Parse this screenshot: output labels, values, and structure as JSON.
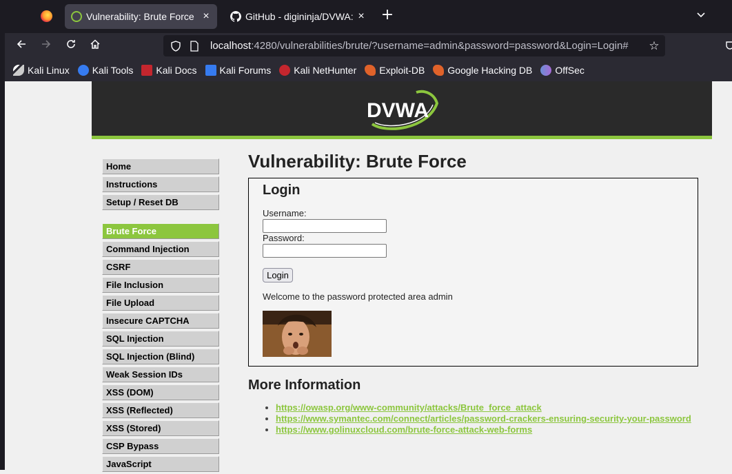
{
  "browser": {
    "tabs": [
      {
        "title": "Vulnerability: Brute Force",
        "active": true
      },
      {
        "title": "GitHub - digininja/DVWA:",
        "active": false
      }
    ],
    "url_host": "localhost",
    "url_rest": ":4280/vulnerabilities/brute/?username=admin&password=password&Login=Login#",
    "bookmarks": [
      {
        "label": "Kali Linux",
        "icon": "kali-dragon-icon"
      },
      {
        "label": "Kali Tools",
        "icon": "kali-tools-icon"
      },
      {
        "label": "Kali Docs",
        "icon": "kali-docs-icon"
      },
      {
        "label": "Kali Forums",
        "icon": "kali-forums-icon"
      },
      {
        "label": "Kali NetHunter",
        "icon": "kali-nethunter-icon"
      },
      {
        "label": "Exploit-DB",
        "icon": "exploit-db-icon"
      },
      {
        "label": "Google Hacking DB",
        "icon": "ghdb-icon"
      },
      {
        "label": "OffSec",
        "icon": "offsec-icon"
      }
    ]
  },
  "dvwa": {
    "logo_text": "DVWA",
    "menu": {
      "group1": [
        "Home",
        "Instructions",
        "Setup / Reset DB"
      ],
      "group2": [
        "Brute Force",
        "Command Injection",
        "CSRF",
        "File Inclusion",
        "File Upload",
        "Insecure CAPTCHA",
        "SQL Injection",
        "SQL Injection (Blind)",
        "Weak Session IDs",
        "XSS (DOM)",
        "XSS (Reflected)",
        "XSS (Stored)",
        "CSP Bypass",
        "JavaScript"
      ],
      "selected": "Brute Force"
    },
    "page_title": "Vulnerability: Brute Force",
    "login": {
      "heading": "Login",
      "username_label": "Username:",
      "username_value": "",
      "password_label": "Password:",
      "password_value": "",
      "button_label": "Login",
      "welcome_message": "Welcome to the password protected area admin"
    },
    "more_info": {
      "heading": "More Information",
      "links": [
        "https://owasp.org/www-community/attacks/Brute_force_attack",
        "https://www.symantec.com/connect/articles/password-crackers-ensuring-security-your-password",
        "https://www.golinuxcloud.com/brute-force-attack-web-forms"
      ]
    }
  },
  "colors": {
    "accent_green": "#8cc63e",
    "header_dark": "#2a2a2a",
    "browser_dark": "#1c1b22",
    "browser_toolbar": "#2b2a33"
  }
}
